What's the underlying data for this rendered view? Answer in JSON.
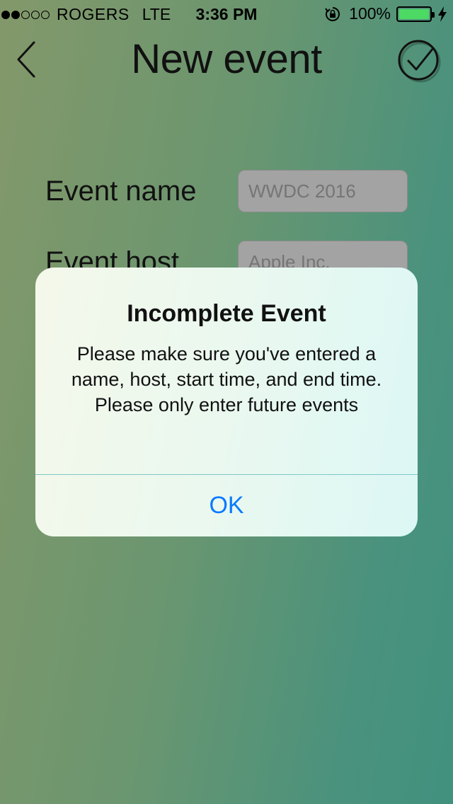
{
  "status_bar": {
    "carrier": "ROGERS",
    "network": "LTE",
    "time": "3:36 PM",
    "battery": "100%",
    "signal_bars_filled": 2,
    "signal_bars_total": 5
  },
  "nav": {
    "title": "New event",
    "back_icon": "chevron-left-icon",
    "done_icon": "checkmark-circle-icon"
  },
  "form": {
    "event_name_label": "Event name",
    "event_name_placeholder": "WWDC 2016",
    "event_host_label": "Event host",
    "event_host_placeholder": "Apple Inc."
  },
  "alert": {
    "title": "Incomplete Event",
    "message": "Please make sure you've entered a name, host, start time, and end time. Please only enter future events",
    "ok_label": "OK"
  },
  "colors": {
    "accent": "#0a7aff",
    "battery": "#4cd964",
    "input_bg": "#a3a3a3"
  }
}
